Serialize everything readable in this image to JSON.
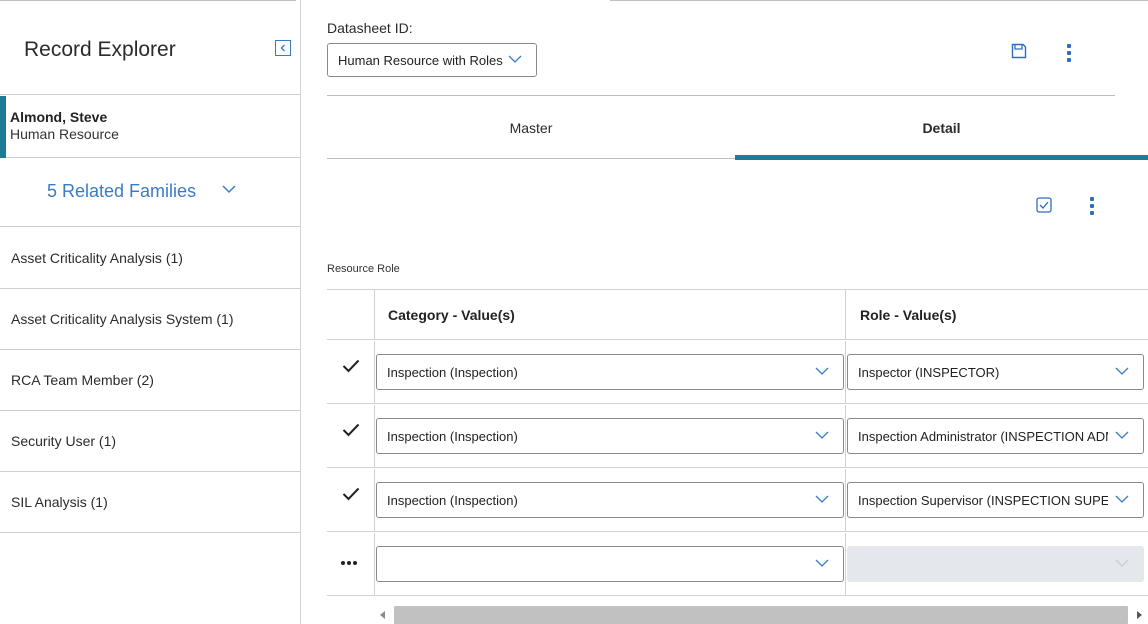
{
  "sidebar": {
    "title": "Record Explorer",
    "record": {
      "name": "Almond, Steve",
      "family": "Human Resource"
    },
    "related_families_label": "5 Related Families",
    "items": [
      {
        "label": "Asset Criticality Analysis (1)"
      },
      {
        "label": "Asset Criticality Analysis System (1)"
      },
      {
        "label": "RCA Team Member (2)"
      },
      {
        "label": "Security User (1)"
      },
      {
        "label": "SIL Analysis (1)"
      }
    ]
  },
  "datasheet": {
    "label": "Datasheet ID:",
    "selected": "Human Resource with Roles"
  },
  "tabs": [
    {
      "label": "Master",
      "active": false
    },
    {
      "label": "Detail",
      "active": true
    }
  ],
  "section_label": "Resource Role",
  "grid": {
    "columns": [
      "Category - Value(s)",
      "Role - Value(s)"
    ],
    "rows": [
      {
        "category": "Inspection (Inspection)",
        "role": "Inspector (INSPECTOR)"
      },
      {
        "category": "Inspection (Inspection)",
        "role": "Inspection Administrator (INSPECTION ADMINISTRATOR)"
      },
      {
        "category": "Inspection (Inspection)",
        "role": "Inspection Supervisor (INSPECTION SUPERVISOR)"
      }
    ],
    "new_row": {
      "category": "",
      "role": ""
    }
  },
  "colors": {
    "accent": "#1e7a96",
    "link": "#3a7bc8",
    "icon": "#2c6fc0",
    "disabled_fill": "#e4e7ec"
  },
  "icons": {
    "collapse": "chevron-left-icon",
    "save": "save-icon",
    "menu": "kebab-menu-icon",
    "select_all": "checkbox-icon",
    "row_saved": "check-icon",
    "row_new": "ellipsis-icon",
    "dropdown": "chevron-down-icon"
  }
}
